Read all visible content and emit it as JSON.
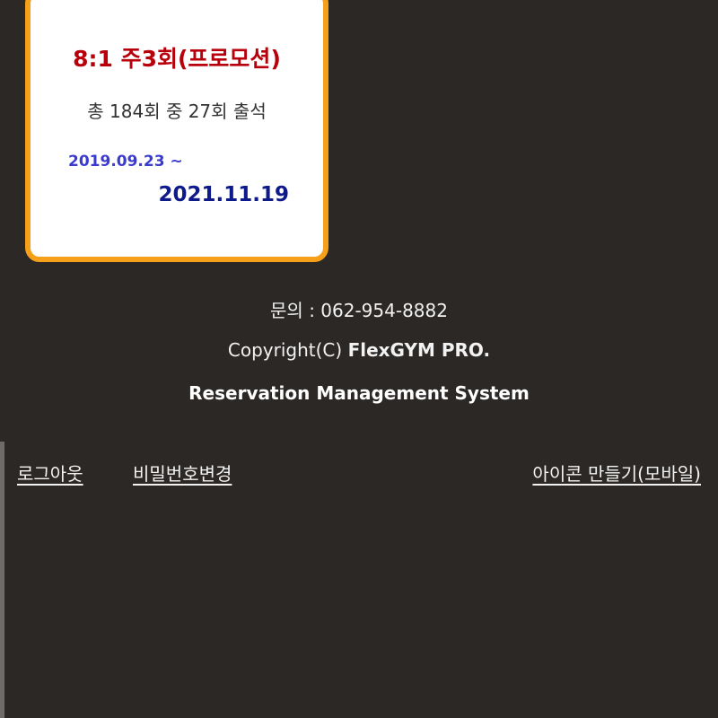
{
  "membership": {
    "title": "8:1 주3회(프로모션)",
    "attendance": "총 184회 중 27회 출석",
    "start_date": "2019.09.23 ~",
    "end_date": "2021.11.19"
  },
  "footer": {
    "contact": "문의 : 062-954-8882",
    "copyright_prefix": "Copyright(C) ",
    "copyright_brand": "FlexGYM PRO.",
    "system_name": "Reservation Management System"
  },
  "links": {
    "logout": "로그아웃",
    "change_password": "비밀번호변경",
    "create_icon": "아이콘 만들기(모바일)"
  },
  "colors": {
    "background": "#2b2826",
    "card_border": "#f6a01a",
    "title": "#b8000c",
    "start_date": "#3a3ad0",
    "end_date": "#0f1a8a"
  }
}
